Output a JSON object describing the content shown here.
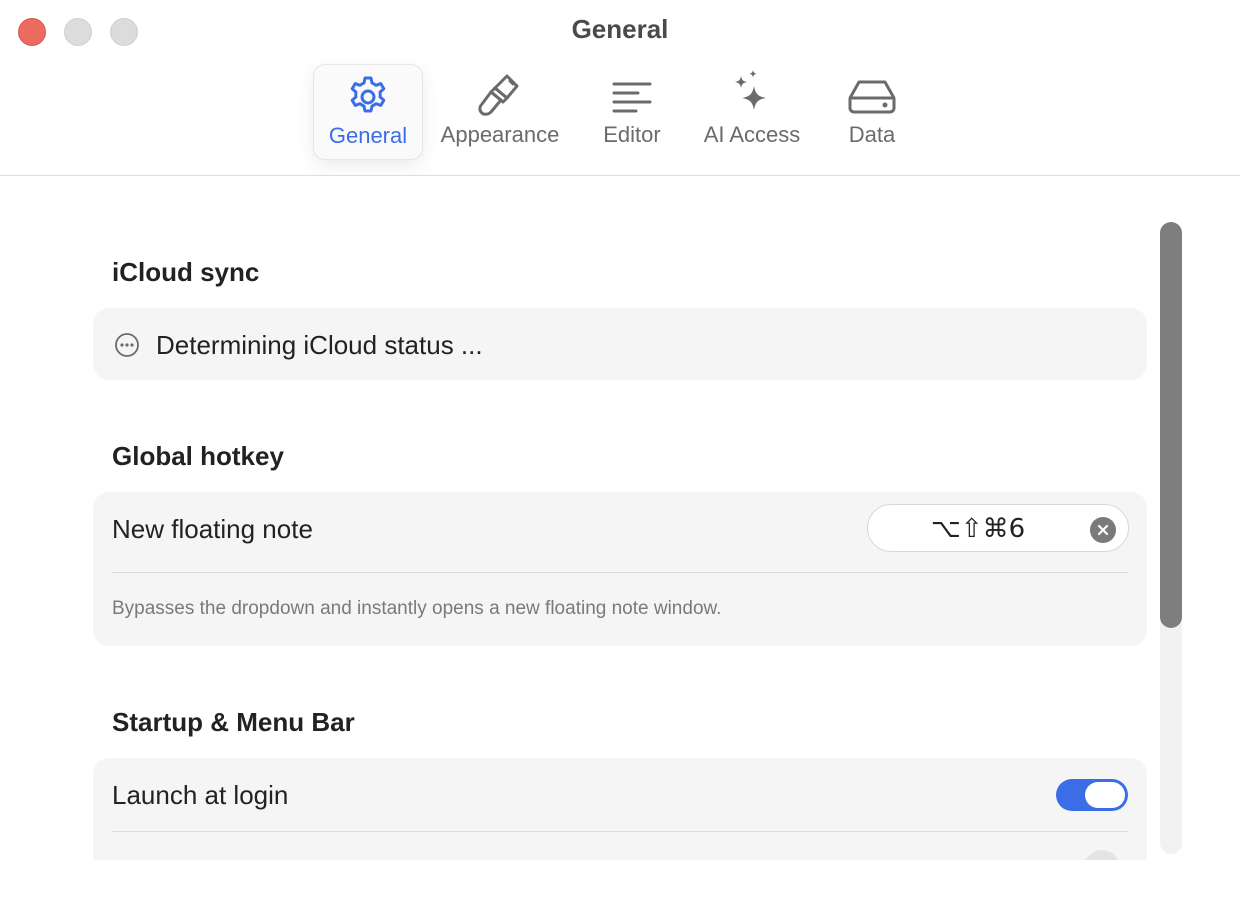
{
  "window": {
    "title": "General"
  },
  "tabs": [
    {
      "label": "General",
      "icon": "gear-icon",
      "active": true
    },
    {
      "label": "Appearance",
      "icon": "paintbrush-icon",
      "active": false
    },
    {
      "label": "Editor",
      "icon": "text-align-icon",
      "active": false
    },
    {
      "label": "AI Access",
      "icon": "sparkles-icon",
      "active": false
    },
    {
      "label": "Data",
      "icon": "drive-icon",
      "active": false
    }
  ],
  "colors": {
    "accent": "#3b6ee6",
    "close": "#ec6b5e",
    "background": "#ffffff",
    "card": "#f5f5f5"
  },
  "icloud": {
    "title": "iCloud sync",
    "status_icon": "ellipsis-circle-icon",
    "status_text": "Determining iCloud status ..."
  },
  "hotkey": {
    "title": "Global hotkey",
    "row_label": "New floating note",
    "shortcut": "⌥⇧⌘6",
    "hint": "Bypasses the dropdown and instantly opens a new floating note window."
  },
  "startup": {
    "title": "Startup & Menu Bar",
    "launch_label": "Launch at login",
    "launch_enabled": true
  }
}
